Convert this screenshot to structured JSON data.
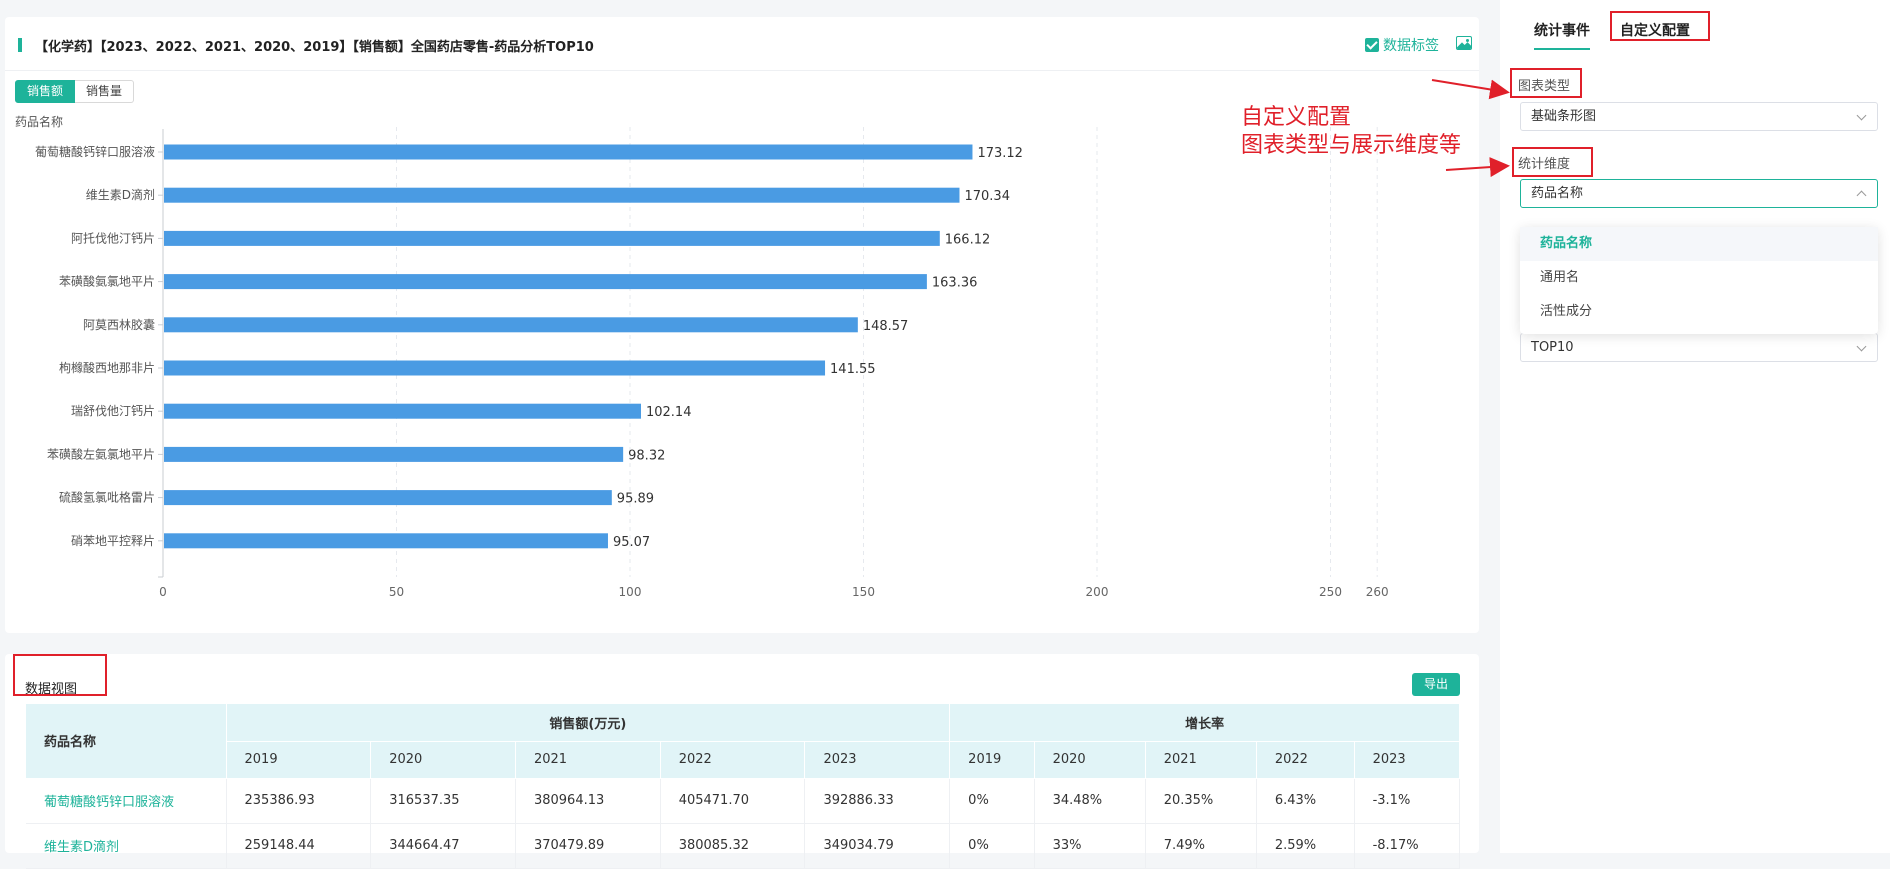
{
  "chart_card": {
    "title": "【化学药】【2023、2022、2021、2020、2019】【销售额】全国药店零售-药品分析TOP10",
    "data_label_toggle": "数据标签",
    "metric_tabs": [
      "销售额",
      "销售量"
    ],
    "y_axis_title": "药品名称"
  },
  "chart_data": {
    "type": "bar",
    "orientation": "horizontal",
    "title": "【化学药】【2023、2022、2021、2020、2019】【销售额】全国药店零售-药品分析TOP10",
    "ylabel": "药品名称",
    "categories": [
      "葡萄糖酸钙锌口服溶液",
      "维生素D滴剂",
      "阿托伐他汀钙片",
      "苯磺酸氨氯地平片",
      "阿莫西林胶囊",
      "枸橼酸西地那非片",
      "瑞舒伐他汀钙片",
      "苯磺酸左氨氯地平片",
      "硫酸氢氯吡格雷片",
      "硝苯地平控释片"
    ],
    "values": [
      173.12,
      170.34,
      166.12,
      163.36,
      148.57,
      141.55,
      102.14,
      98.32,
      95.89,
      95.07
    ],
    "x_ticks": [
      0,
      50,
      100,
      150,
      200,
      250,
      260
    ],
    "xlim": [
      0,
      260
    ],
    "grid": true,
    "data_labels": true,
    "bar_color": "#4a9be3"
  },
  "table_card": {
    "title": "数据视图",
    "export_label": "导出",
    "headers": {
      "drug": "药品名称",
      "sales_group": "销售额(万元)",
      "growth_group": "增长率",
      "years": [
        "2019",
        "2020",
        "2021",
        "2022",
        "2023"
      ]
    },
    "rows": [
      {
        "name": "葡萄糖酸钙锌口服溶液",
        "sales": [
          "235386.93",
          "316537.35",
          "380964.13",
          "405471.70",
          "392886.33"
        ],
        "growth": [
          "0%",
          "34.48%",
          "20.35%",
          "6.43%",
          "-3.1%"
        ]
      },
      {
        "name": "维生素D滴剂",
        "sales": [
          "259148.44",
          "344664.47",
          "370479.89",
          "380085.32",
          "349034.79"
        ],
        "growth": [
          "0%",
          "33%",
          "7.49%",
          "2.59%",
          "-8.17%"
        ]
      }
    ]
  },
  "side_panel": {
    "tabs": [
      "统计事件",
      "自定义配置"
    ],
    "chart_type_label": "图表类型",
    "chart_type_value": "基础条形图",
    "dimension_label": "统计维度",
    "dimension_value": "药品名称",
    "dimension_options": [
      "药品名称",
      "通用名",
      "活性成分"
    ],
    "top_value": "TOP10"
  },
  "annotation": {
    "line1": "自定义配置",
    "line2": "图表类型与展示维度等",
    "color": "#e0202a"
  },
  "colors": {
    "accent": "#1eb39a",
    "bar": "#4a9be3",
    "annotation": "#e0202a"
  }
}
